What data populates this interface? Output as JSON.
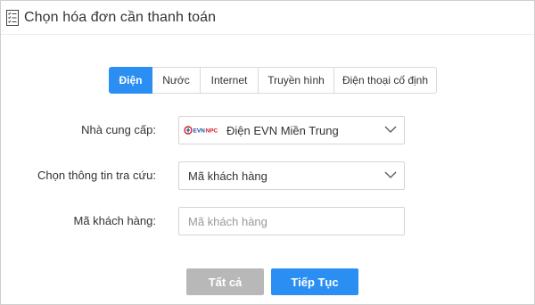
{
  "header": {
    "title": "Chọn hóa đơn cần thanh toán",
    "icon": "checklist-icon"
  },
  "tabs": [
    {
      "label": "Điện",
      "active": true
    },
    {
      "label": "Nước",
      "active": false
    },
    {
      "label": "Internet",
      "active": false
    },
    {
      "label": "Truyền hình",
      "active": false
    },
    {
      "label": "Điện thoại cố định",
      "active": false
    }
  ],
  "form": {
    "provider": {
      "label": "Nhà cung cấp:",
      "logo_text": "EVNNPC",
      "value": "Điện EVN Miền Trung"
    },
    "lookup": {
      "label": "Chọn thông tin tra cứu:",
      "value": "Mã khách hàng"
    },
    "customer_code": {
      "label": "Mã khách hàng:",
      "placeholder": "Mã khách hàng",
      "value": ""
    }
  },
  "buttons": {
    "all_label": "Tất cả",
    "next_label": "Tiếp Tục"
  },
  "colors": {
    "accent": "#2b8ef3",
    "disabled": "#b8b8b8",
    "logo_red": "#d32027",
    "logo_blue": "#1b4f9c"
  }
}
